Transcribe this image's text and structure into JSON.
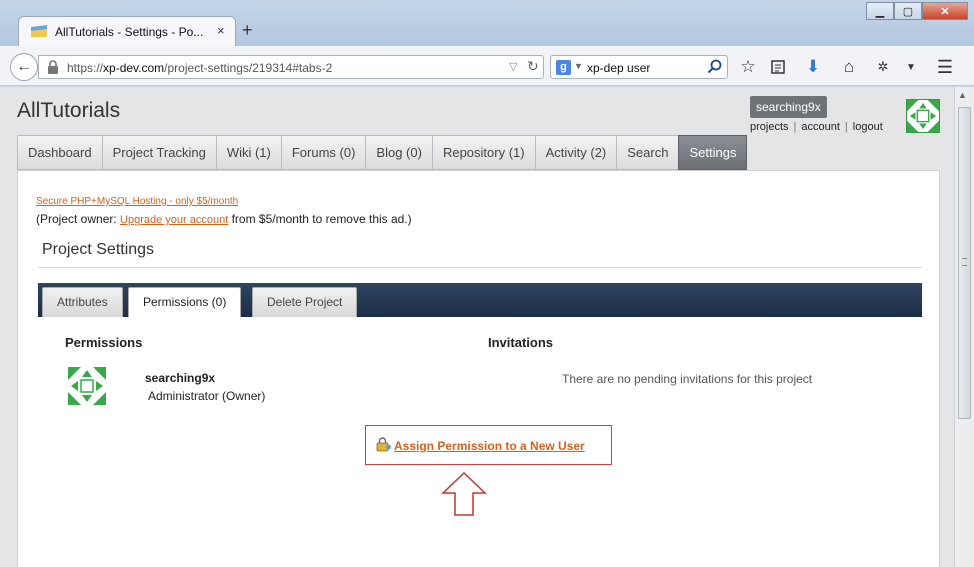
{
  "browser": {
    "tab_title": "AllTutorials - Settings - Po...",
    "tab_close": "×",
    "new_tab": "+",
    "url_prefix": "https://",
    "url_host": "xp-dev.com",
    "url_path": "/project-settings/219314#tabs-2",
    "search_engine": "g",
    "search_text": "xp-dep user",
    "window_minimize": "▁",
    "window_maximize": "▢",
    "window_close": "✕"
  },
  "site": {
    "title": "AllTutorials",
    "username": "searching9x",
    "user_links": [
      "projects",
      "account",
      "logout"
    ],
    "nav": [
      "Dashboard",
      "Project Tracking",
      "Wiki (1)",
      "Forums (0)",
      "Blog (0)",
      "Repository (1)",
      "Activity (2)",
      "Search",
      "Settings"
    ],
    "active_nav": "Settings"
  },
  "ad": {
    "link": "Secure PHP+MySQL Hosting - only $5/month",
    "prefix": "(Project owner: ",
    "upgrade": "Upgrade your account",
    "suffix": " from $5/month to remove this ad.)"
  },
  "page": {
    "heading": "Project Settings",
    "tabs": [
      "Attributes",
      "Permissions (0)",
      "Delete Project"
    ],
    "active_tab": "Permissions (0)"
  },
  "permissions": {
    "title": "Permissions",
    "member_name": "searching9x",
    "member_role": "Administrator (Owner)",
    "assign_label": "Assign Permission to a New User"
  },
  "invitations": {
    "title": "Invitations",
    "empty_text": "There are no pending invitations for this project"
  },
  "colors": {
    "accent_orange": "#d9601c",
    "highlight_red": "#d23c3c",
    "tabstrip_navy": "#1c2e44",
    "avatar_green": "#2f9d3e"
  }
}
